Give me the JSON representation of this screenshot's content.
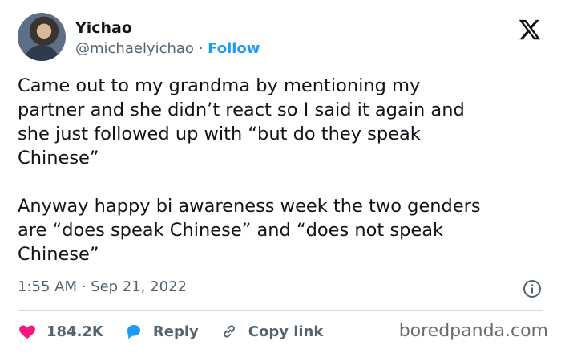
{
  "author": {
    "name": "Yichao",
    "handle": "@michaelyichao",
    "separator": "·",
    "follow_label": "Follow"
  },
  "tweet": {
    "text": "Came out to my grandma by mentioning my\npartner and she didn’t react so I said it again and\nshe just followed up with “but do they speak\nChinese”\n\nAnyway happy bi awareness week the two genders\nare “does speak Chinese” and “does not speak\nChinese”",
    "timestamp": "1:55 AM · Sep 21, 2022"
  },
  "actions": {
    "likes": "184.2K",
    "reply_label": "Reply",
    "copy_link_label": "Copy link"
  },
  "watermark": "boredpanda.com",
  "icons": {
    "logo": "x-logo-icon",
    "info": "info-icon",
    "like": "heart-icon",
    "reply": "reply-bubble-icon",
    "link": "link-icon"
  },
  "colors": {
    "accent": "#1d9bf0",
    "heart": "#f91880",
    "text": "#0f1419",
    "secondary": "#536471"
  }
}
